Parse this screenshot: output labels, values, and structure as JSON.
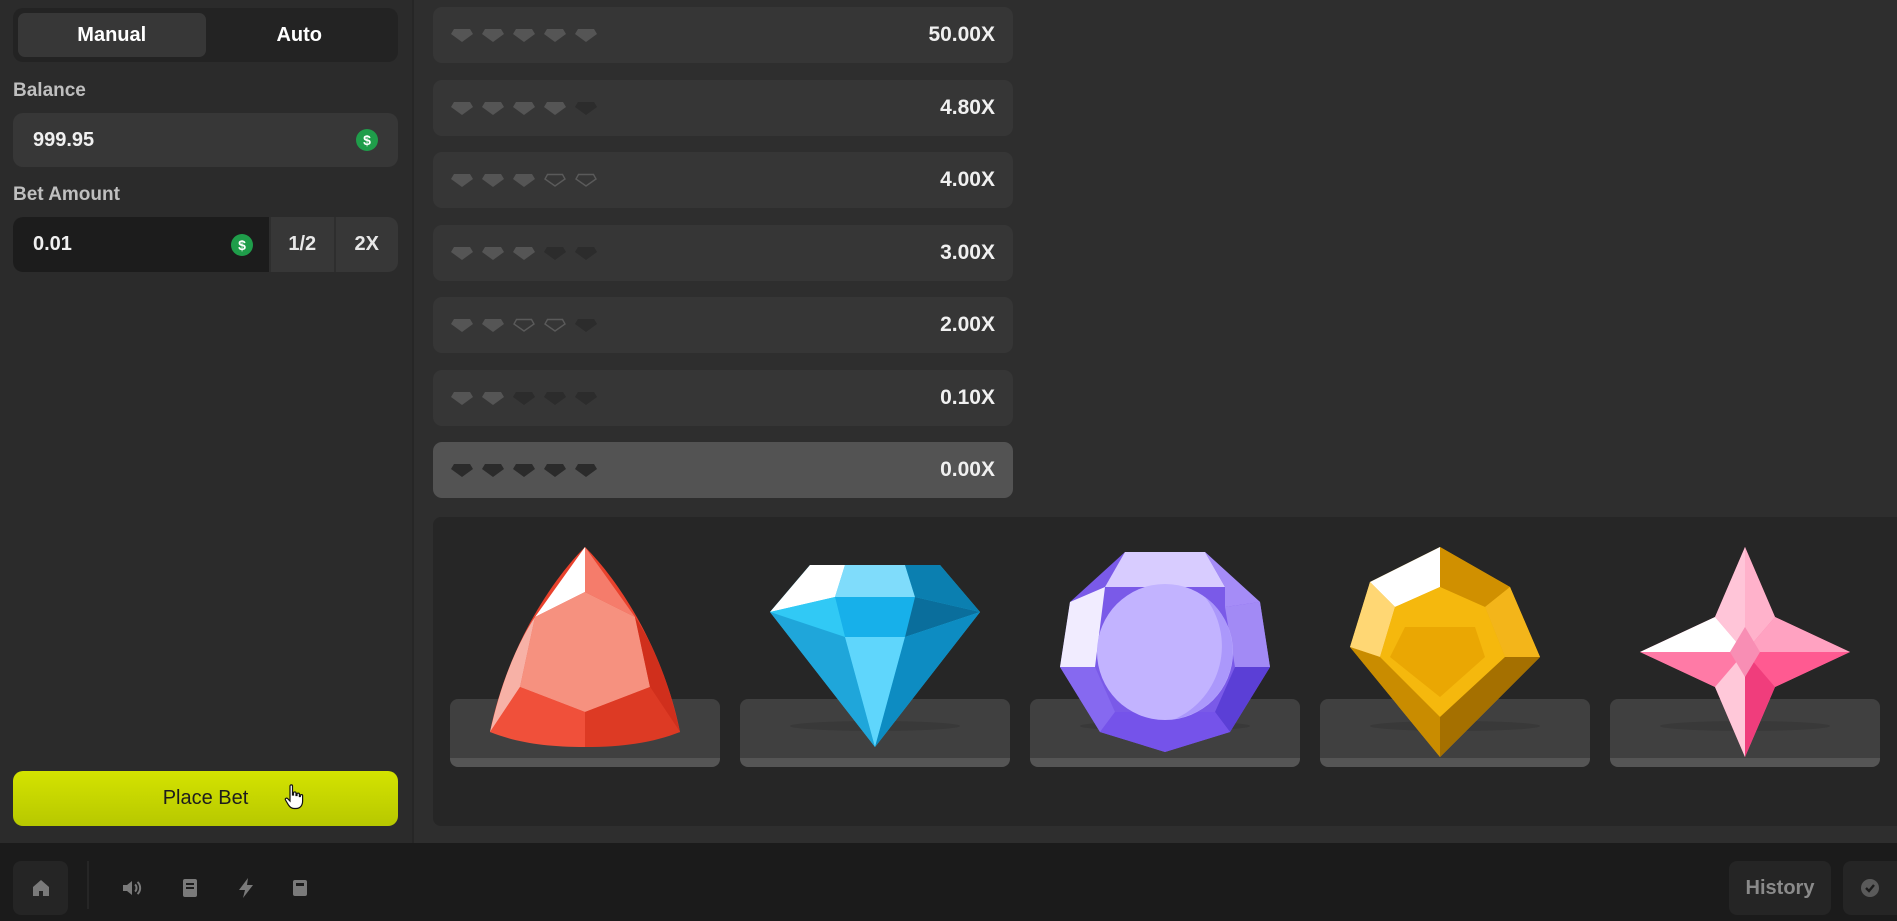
{
  "sidebar": {
    "modes": [
      "Manual",
      "Auto"
    ],
    "active_mode": "Manual",
    "balance_label": "Balance",
    "balance_value": "999.95",
    "currency_symbol": "$",
    "bet_label": "Bet Amount",
    "bet_value": "0.01",
    "half_label": "1/2",
    "double_label": "2X",
    "place_bet_label": "Place Bet",
    "place_bet_color": "#c8d800"
  },
  "payouts": [
    {
      "multiplier": "50.00X",
      "pattern": "5 of a kind",
      "slots": [
        "filled",
        "filled",
        "filled",
        "filled",
        "filled"
      ]
    },
    {
      "multiplier": "4.80X",
      "pattern": "4 of a kind",
      "slots": [
        "filled",
        "filled",
        "filled",
        "filled",
        "dark"
      ]
    },
    {
      "multiplier": "4.00X",
      "pattern": "full house",
      "slots": [
        "filled",
        "filled",
        "filled",
        "outline",
        "outline"
      ]
    },
    {
      "multiplier": "3.00X",
      "pattern": "3 of a kind",
      "slots": [
        "filled",
        "filled",
        "filled",
        "dark",
        "dark"
      ]
    },
    {
      "multiplier": "2.00X",
      "pattern": "two pair",
      "slots": [
        "filled",
        "filled",
        "outline",
        "outline",
        "dark"
      ]
    },
    {
      "multiplier": "0.10X",
      "pattern": "one pair",
      "slots": [
        "filled",
        "filled",
        "dark",
        "dark",
        "dark"
      ]
    },
    {
      "multiplier": "0.00X",
      "pattern": "no match",
      "slots": [
        "dark",
        "dark",
        "dark",
        "dark",
        "dark"
      ],
      "current": true
    }
  ],
  "board": {
    "gems": [
      {
        "name": "red-trillion-gem-icon",
        "color": "#f0503a"
      },
      {
        "name": "blue-diamond-gem-icon",
        "color": "#29c3f2"
      },
      {
        "name": "purple-octagon-gem-icon",
        "color": "#9a7cf5"
      },
      {
        "name": "yellow-kite-gem-icon",
        "color": "#f0b10e"
      },
      {
        "name": "pink-star-gem-icon",
        "color": "#f76a9b"
      }
    ]
  },
  "bottombar": {
    "icons": [
      "home-icon",
      "volume-icon",
      "book-icon",
      "lightning-icon",
      "calculator-icon"
    ],
    "history_label": "History",
    "fairness_icon": "check-badge-icon"
  }
}
